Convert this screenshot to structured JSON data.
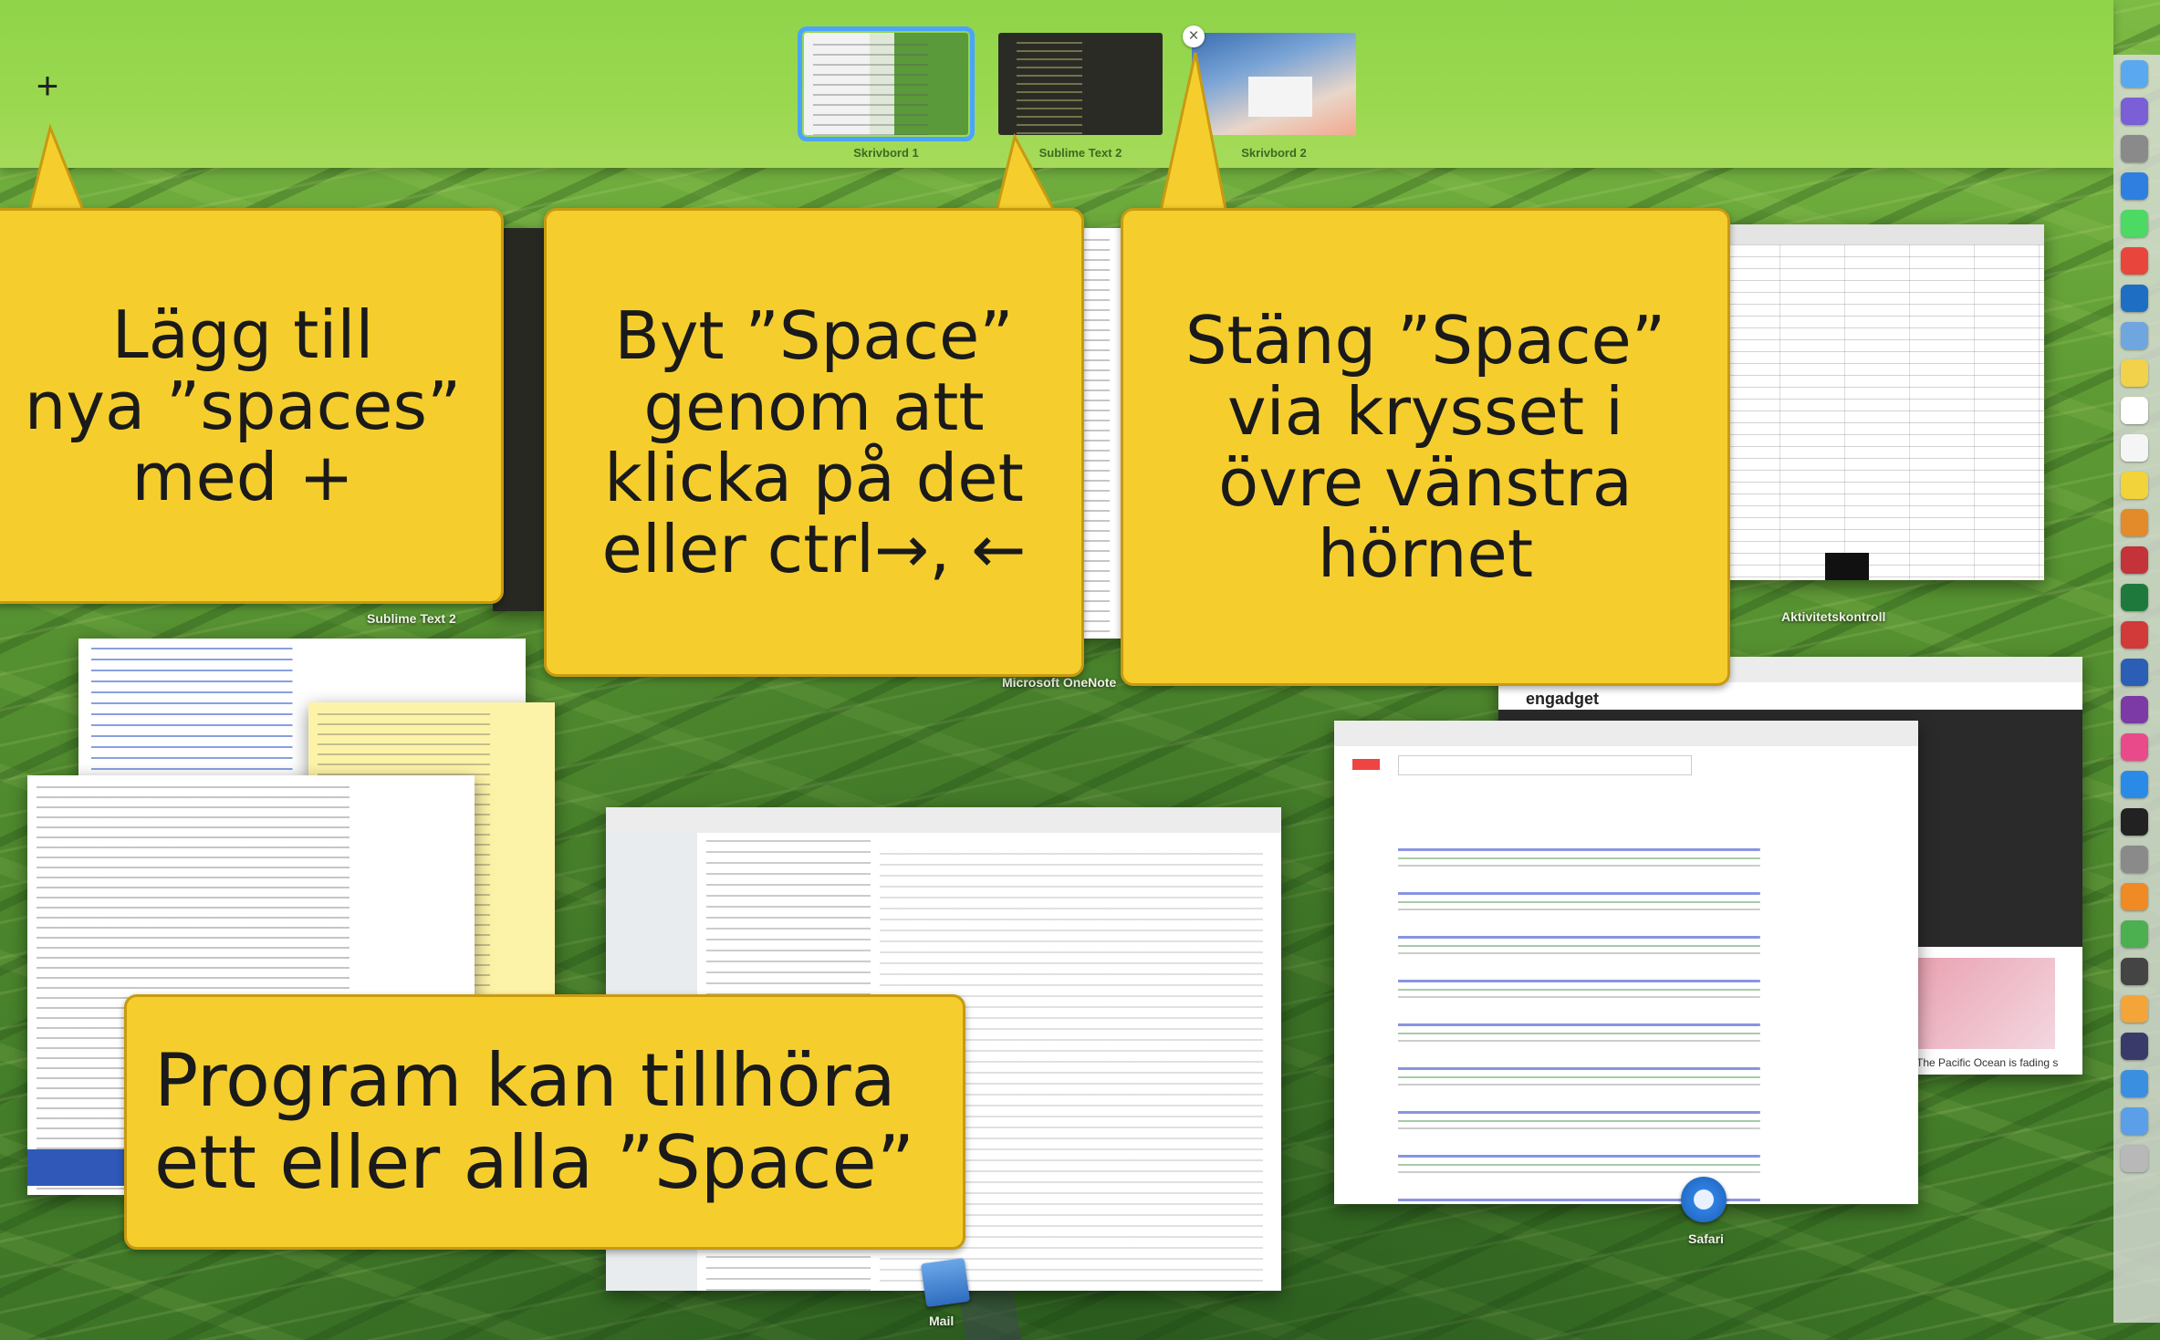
{
  "spaces_bar": {
    "add_symbol": "+",
    "close_symbol": "×",
    "spaces": [
      {
        "label": "Skrivbord 1"
      },
      {
        "label": "Sublime Text 2"
      },
      {
        "label": "Skrivbord 2"
      }
    ]
  },
  "windows": {
    "sublime_label": "Sublime Text 2",
    "onenote_label": "Microsoft OneNote",
    "activity_label": "Aktivitetskontroll",
    "safari_label": "Safari",
    "mail_label": "Mail",
    "pacific_caption": "The Pacific Ocean is fading s",
    "engadget_logo": "engadget"
  },
  "callouts": {
    "add": "Lägg till\nnya ”spaces”\nmed +",
    "switch": "Byt ”Space”\ngenom att\nklicka på det\neller ctrl→, ←",
    "close": "Stäng ”Space”\nvia krysset i\növre vänstra\nhörnet",
    "apps": "Program kan tillhöra\nett eller alla ”Space”"
  },
  "dock": {
    "icons": [
      "finder-icon",
      "siri-icon",
      "launchpad-icon",
      "safari-icon",
      "messages-icon",
      "chrome-icon",
      "outlook-icon",
      "preview-icon",
      "notes-icon",
      "calendar-icon",
      "textedit-icon",
      "stickies-icon",
      "books-icon",
      "camera-icon",
      "excel-icon",
      "photo-booth-icon",
      "word-icon",
      "onenote-icon",
      "itunes-icon",
      "app-store-icon",
      "terminal-icon",
      "system-preferences-icon",
      "sublime-icon",
      "maps-icon",
      "activity-monitor-icon",
      "photos-icon",
      "quicktime-icon",
      "downloads-icon",
      "documents-icon",
      "trash-icon"
    ]
  }
}
